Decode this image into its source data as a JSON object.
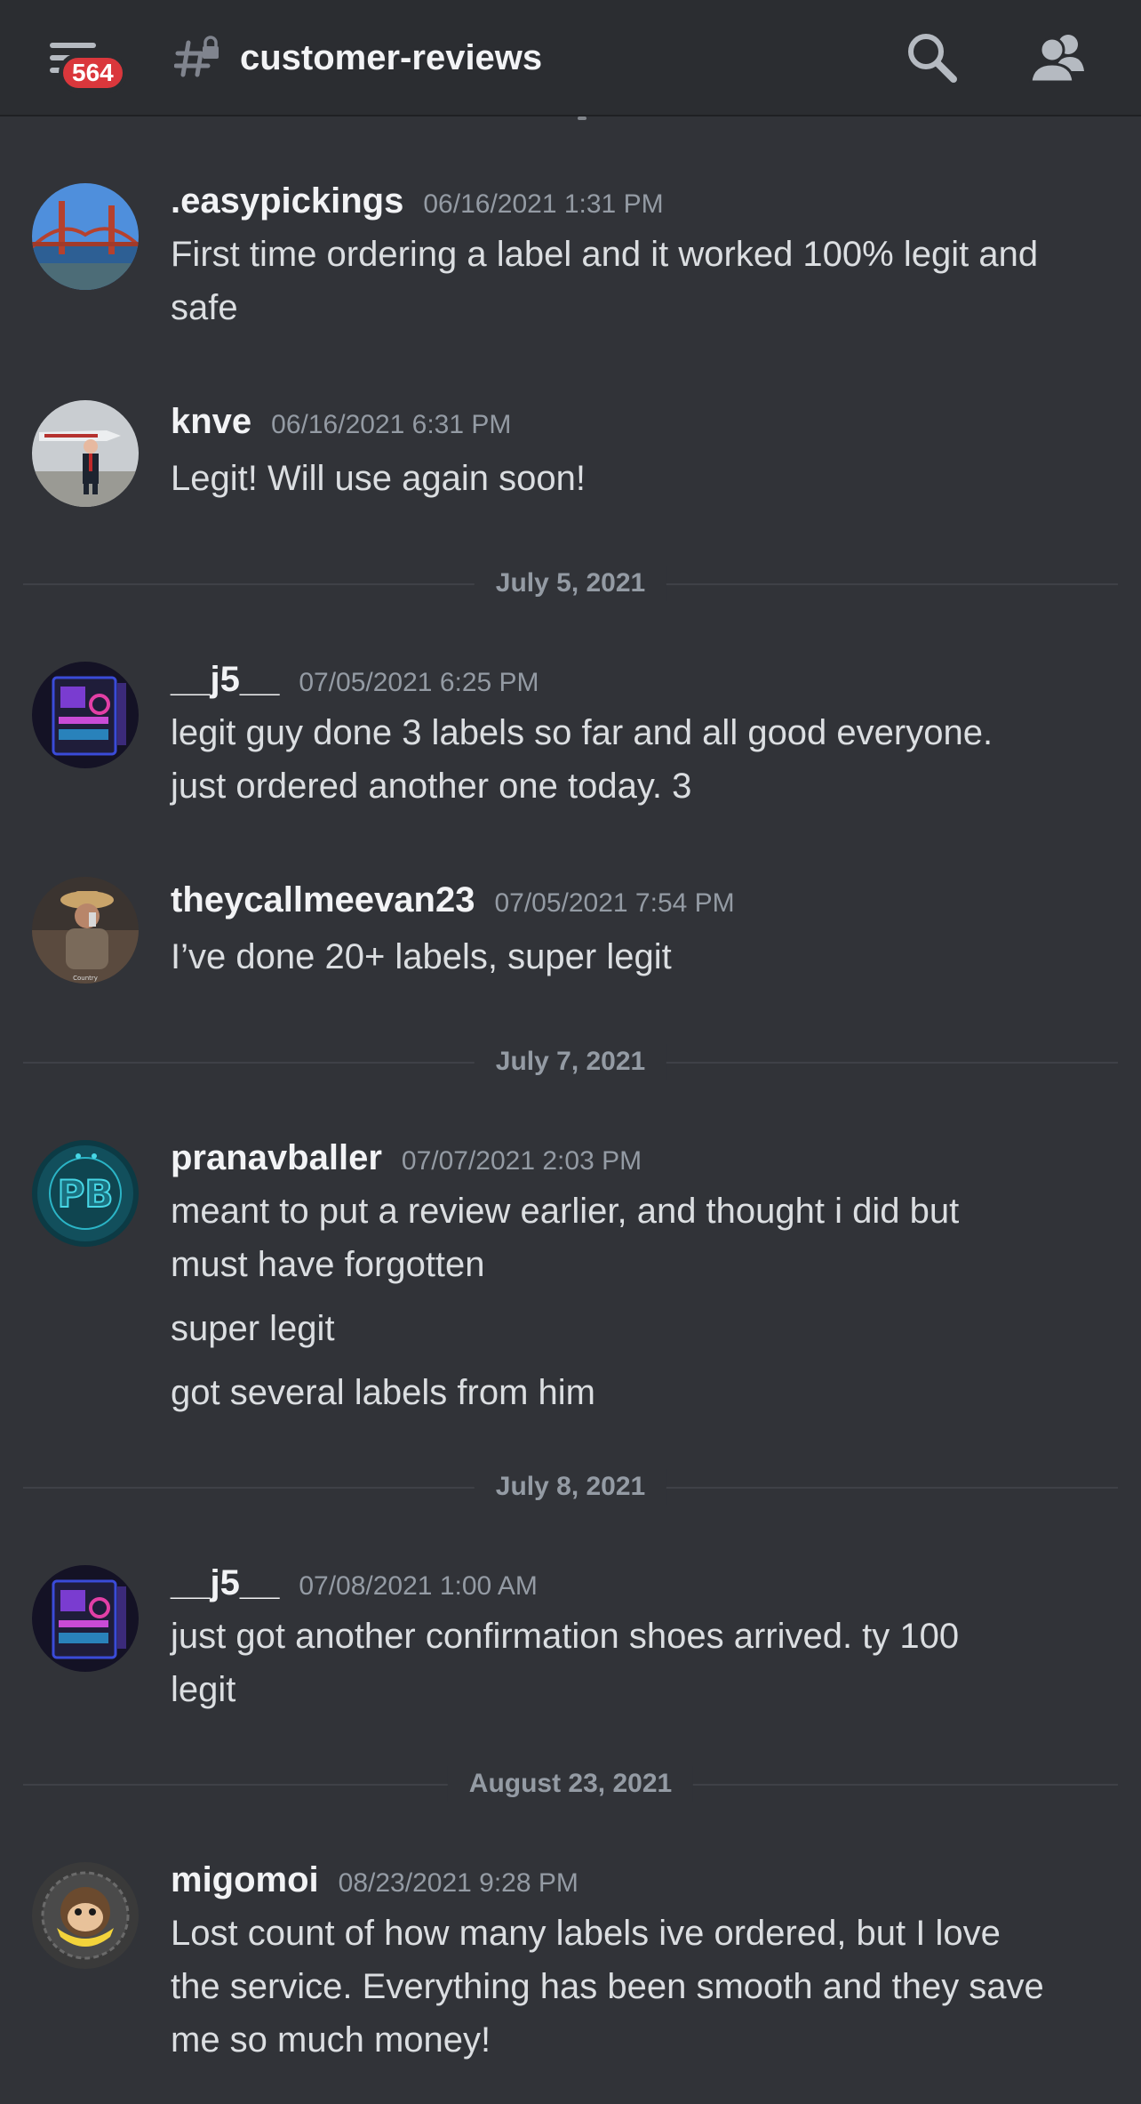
{
  "header": {
    "unread_badge": "564",
    "channel_name": "customer-reviews",
    "menu_icon": "hamburger-menu-icon",
    "channel_icon": "locked-text-channel-icon",
    "search_icon": "search-icon",
    "members_icon": "members-icon"
  },
  "colors": {
    "background": "#313338",
    "header_background": "#2b2d31",
    "badge": "#da373c",
    "author": "#f2f3f5",
    "timestamp": "#949ba4",
    "message_text": "#dbdee1"
  },
  "messages": [
    {
      "author": ".easypickings",
      "timestamp": "06/16/2021 1:31 PM",
      "lines": [
        "First time ordering a label and it worked 100% legit and",
        "safe"
      ]
    },
    {
      "author": "knve",
      "timestamp": "06/16/2021 6:31 PM",
      "lines": [
        "Legit! Will use again soon!"
      ]
    },
    {
      "author": "__j5__",
      "timestamp": "07/05/2021 6:25 PM",
      "lines": [
        "legit guy done 3 labels so far and all good everyone.",
        "just ordered another one today. 3"
      ]
    },
    {
      "author": "theycallmeevan23",
      "timestamp": "07/05/2021 7:54 PM",
      "lines": [
        "I’ve done 20+ labels, super legit"
      ]
    },
    {
      "author": "pranavballer",
      "timestamp": "07/07/2021 2:03 PM",
      "lines": [
        "meant to put a review earlier, and thought i did but",
        "must have forgotten",
        "super legit",
        "got several labels from him"
      ]
    },
    {
      "author": "__j5__",
      "timestamp": "07/08/2021 1:00 AM",
      "lines": [
        "just got another confirmation shoes arrived. ty 100",
        "legit"
      ]
    },
    {
      "author": "migomoi",
      "timestamp": "08/23/2021 9:28 PM",
      "lines": [
        "Lost count of how many labels ive ordered, but I love",
        "the service. Everything has been smooth and they save",
        "me so much money!"
      ]
    }
  ],
  "dividers": [
    "July 5, 2021",
    "July 7, 2021",
    "July 8, 2021",
    "August 23, 2021"
  ]
}
